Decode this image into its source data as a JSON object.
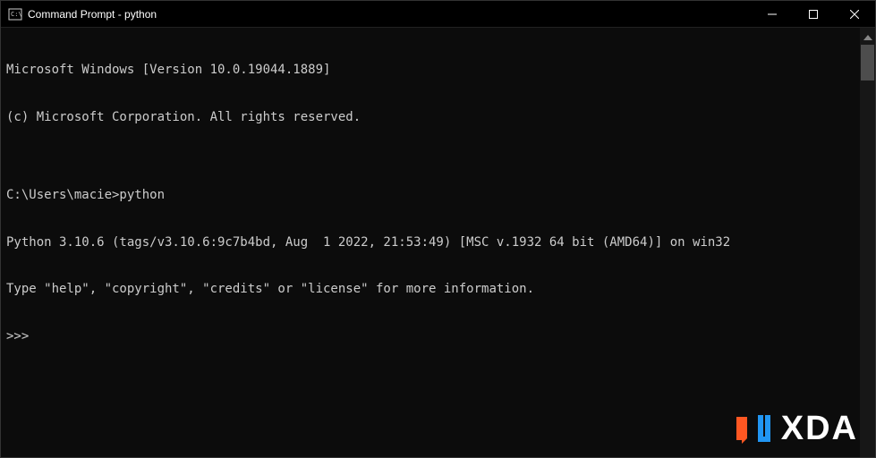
{
  "titlebar": {
    "title": "Command Prompt - python"
  },
  "terminal": {
    "line1": "Microsoft Windows [Version 10.0.19044.1889]",
    "line2": "(c) Microsoft Corporation. All rights reserved.",
    "blank1": "",
    "prompt_line": "C:\\Users\\macie>python",
    "python_version": "Python 3.10.6 (tags/v3.10.6:9c7b4bd, Aug  1 2022, 21:53:49) [MSC v.1932 64 bit (AMD64)] on win32",
    "python_help": "Type \"help\", \"copyright\", \"credits\" or \"license\" for more information.",
    "repl_prompt": ">>> "
  },
  "watermark": {
    "text": "XDA"
  }
}
